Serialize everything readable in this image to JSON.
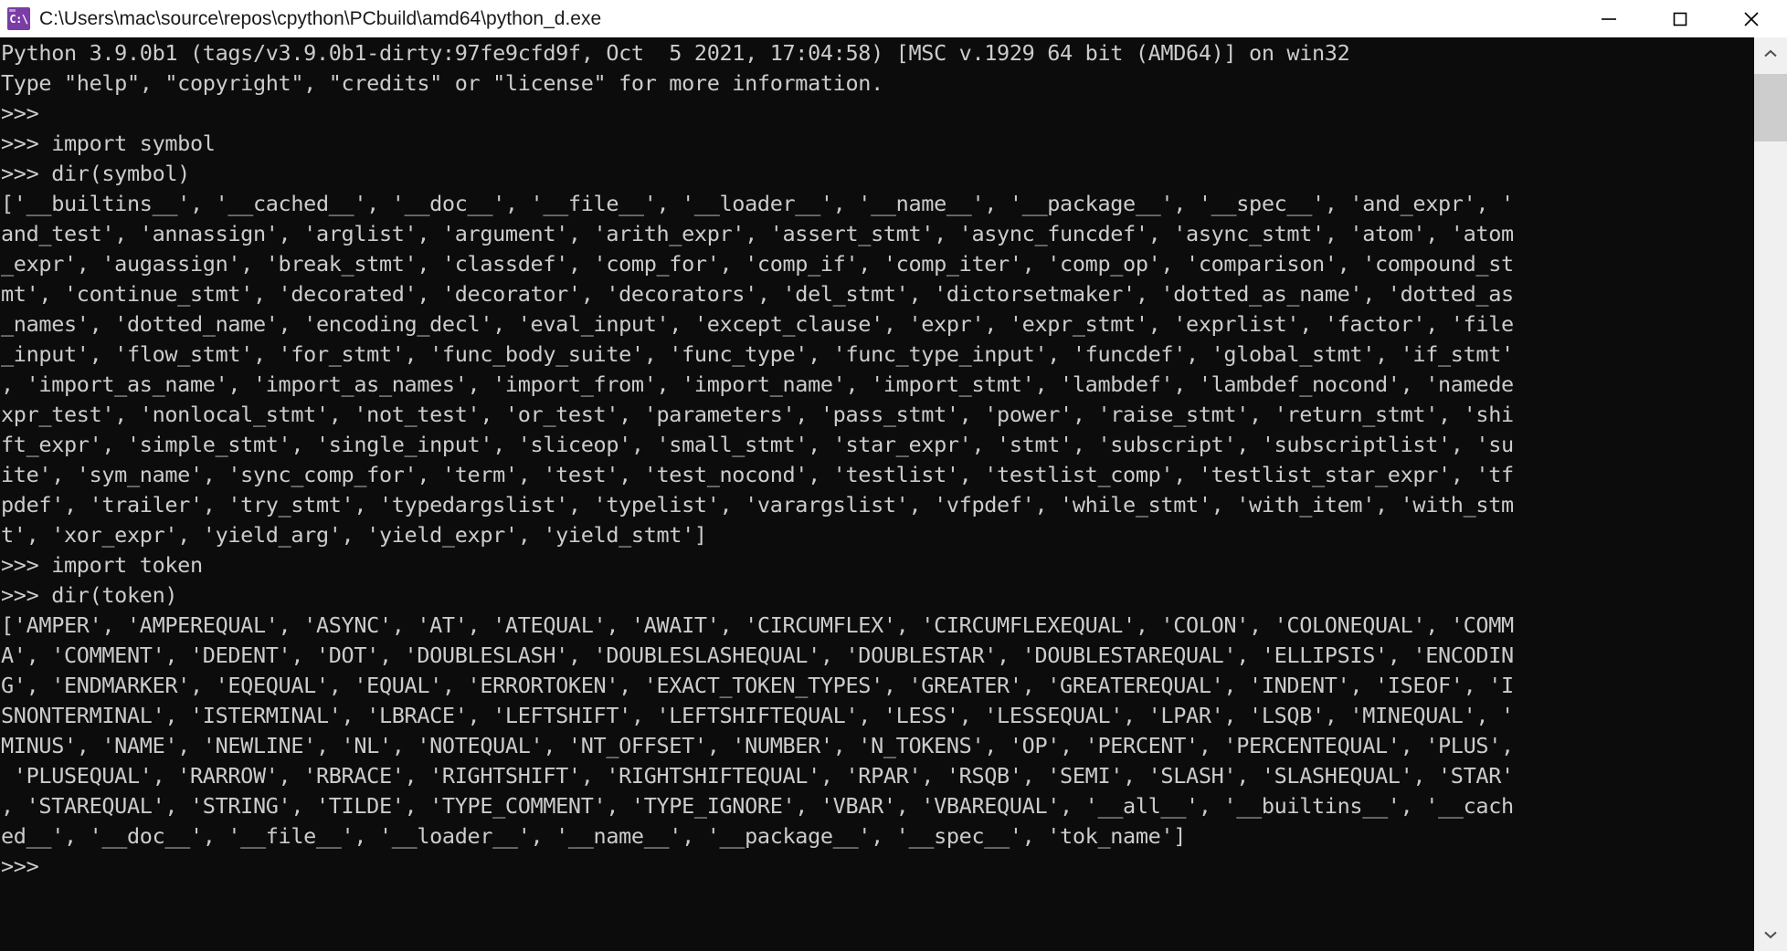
{
  "window": {
    "title": "C:\\Users\\mac\\source\\repos\\cpython\\PCbuild\\amd64\\python_d.exe",
    "icon_glyph": "C:\\",
    "icon_name": "console-app-icon",
    "icon_color": "#7a3da6",
    "titlebar_bg": "#ffffff",
    "controls": {
      "minimize_label": "Minimize",
      "maximize_label": "Maximize",
      "close_label": "Close"
    }
  },
  "console": {
    "background": "#0c0c0c",
    "foreground": "#cccccc",
    "font_size_px": 23.5,
    "line_height_px": 33,
    "lines": [
      "Python 3.9.0b1 (tags/v3.9.0b1-dirty:97fe9cfd9f, Oct  5 2021, 17:04:58) [MSC v.1929 64 bit (AMD64)] on win32",
      "Type \"help\", \"copyright\", \"credits\" or \"license\" for more information.",
      ">>>",
      ">>> import symbol",
      ">>> dir(symbol)",
      "['__builtins__', '__cached__', '__doc__', '__file__', '__loader__', '__name__', '__package__', '__spec__', 'and_expr', '",
      "and_test', 'annassign', 'arglist', 'argument', 'arith_expr', 'assert_stmt', 'async_funcdef', 'async_stmt', 'atom', 'atom",
      "_expr', 'augassign', 'break_stmt', 'classdef', 'comp_for', 'comp_if', 'comp_iter', 'comp_op', 'comparison', 'compound_st",
      "mt', 'continue_stmt', 'decorated', 'decorator', 'decorators', 'del_stmt', 'dictorsetmaker', 'dotted_as_name', 'dotted_as",
      "_names', 'dotted_name', 'encoding_decl', 'eval_input', 'except_clause', 'expr', 'expr_stmt', 'exprlist', 'factor', 'file",
      "_input', 'flow_stmt', 'for_stmt', 'func_body_suite', 'func_type', 'func_type_input', 'funcdef', 'global_stmt', 'if_stmt'",
      ", 'import_as_name', 'import_as_names', 'import_from', 'import_name', 'import_stmt', 'lambdef', 'lambdef_nocond', 'namede",
      "xpr_test', 'nonlocal_stmt', 'not_test', 'or_test', 'parameters', 'pass_stmt', 'power', 'raise_stmt', 'return_stmt', 'shi",
      "ft_expr', 'simple_stmt', 'single_input', 'sliceop', 'small_stmt', 'star_expr', 'stmt', 'subscript', 'subscriptlist', 'su",
      "ite', 'sym_name', 'sync_comp_for', 'term', 'test', 'test_nocond', 'testlist', 'testlist_comp', 'testlist_star_expr', 'tf",
      "pdef', 'trailer', 'try_stmt', 'typedargslist', 'typelist', 'varargslist', 'vfpdef', 'while_stmt', 'with_item', 'with_stm",
      "t', 'xor_expr', 'yield_arg', 'yield_expr', 'yield_stmt']",
      ">>> import token",
      ">>> dir(token)",
      "['AMPER', 'AMPEREQUAL', 'ASYNC', 'AT', 'ATEQUAL', 'AWAIT', 'CIRCUMFLEX', 'CIRCUMFLEXEQUAL', 'COLON', 'COLONEQUAL', 'COMM",
      "A', 'COMMENT', 'DEDENT', 'DOT', 'DOUBLESLASH', 'DOUBLESLASHEQUAL', 'DOUBLESTAR', 'DOUBLESTAREQUAL', 'ELLIPSIS', 'ENCODIN",
      "G', 'ENDMARKER', 'EQEQUAL', 'EQUAL', 'ERRORTOKEN', 'EXACT_TOKEN_TYPES', 'GREATER', 'GREATEREQUAL', 'INDENT', 'ISEOF', 'I",
      "SNONTERMINAL', 'ISTERMINAL', 'LBRACE', 'LEFTSHIFT', 'LEFTSHIFTEQUAL', 'LESS', 'LESSEQUAL', 'LPAR', 'LSQB', 'MINEQUAL', '",
      "MINUS', 'NAME', 'NEWLINE', 'NL', 'NOTEQUAL', 'NT_OFFSET', 'NUMBER', 'N_TOKENS', 'OP', 'PERCENT', 'PERCENTEQUAL', 'PLUS',",
      " 'PLUSEQUAL', 'RARROW', 'RBRACE', 'RIGHTSHIFT', 'RIGHTSHIFTEQUAL', 'RPAR', 'RSQB', 'SEMI', 'SLASH', 'SLASHEQUAL', 'STAR'",
      ", 'STAREQUAL', 'STRING', 'TILDE', 'TYPE_COMMENT', 'TYPE_IGNORE', 'VBAR', 'VBAREQUAL', '__all__', '__builtins__', '__cach",
      "ed__', '__doc__', '__file__', '__loader__', '__name__', '__package__', '__spec__', 'tok_name']",
      ">>>"
    ]
  },
  "scrollbar": {
    "orientation": "vertical",
    "up_arrow_name": "scroll-up-arrow",
    "down_arrow_name": "scroll-down-arrow",
    "thumb_name": "scrollbar-thumb",
    "track_bg": "#f0f0f0",
    "thumb_bg": "#cdcdcd"
  }
}
